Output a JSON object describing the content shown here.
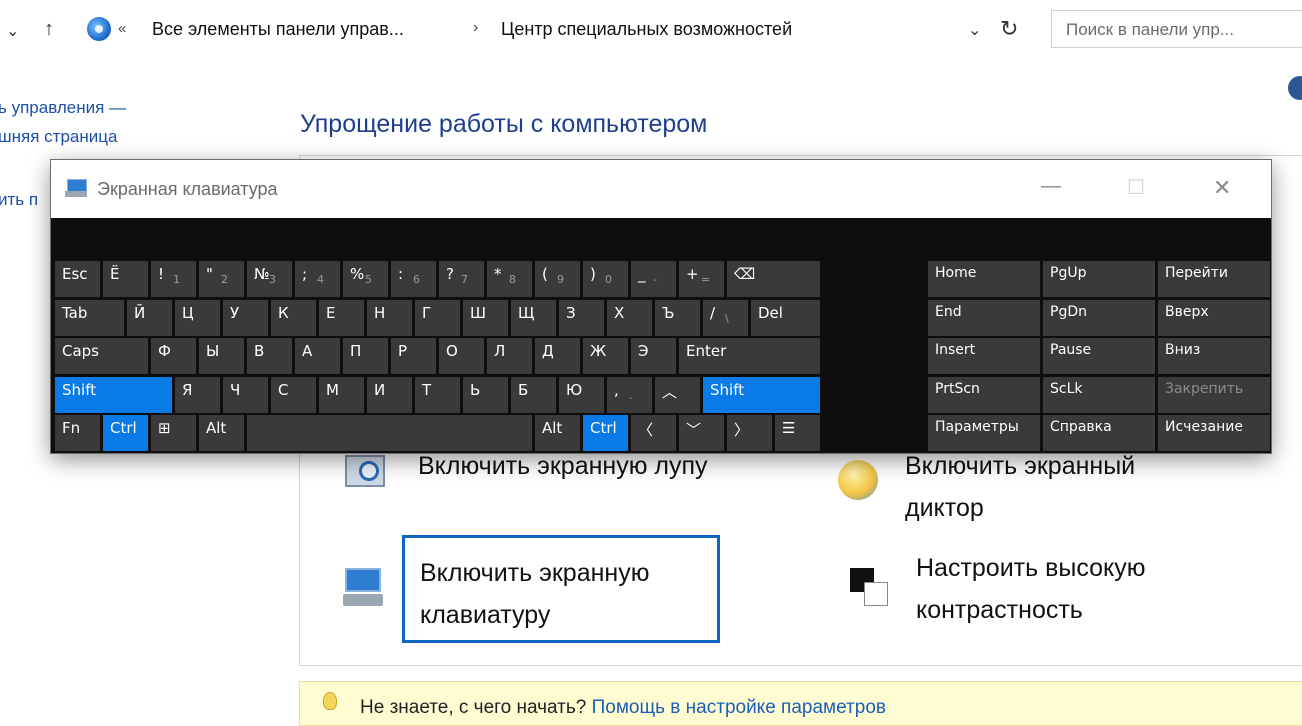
{
  "address_bar": {
    "overflow": "«",
    "crumb1": "Все элементы панели управ...",
    "separator": "›",
    "crumb2": "Центр специальных возможностей",
    "search_placeholder": "Поиск в панели упр..."
  },
  "left_pane": {
    "link_line1": "ь управления —",
    "link_line2": "шняя страница",
    "link_partial": "ить п"
  },
  "main": {
    "title": "Упрощение работы с компьютером",
    "options": {
      "magnifier": "Включить экранную лупу",
      "narrator_line1": "Включить экранный",
      "narrator_line2": "диктор",
      "keyboard_line1": "Включить экранную",
      "keyboard_line2": "клавиатуру",
      "contrast_line1": "Настроить высокую",
      "contrast_line2": "контрастность"
    },
    "tip": {
      "text": "Не знаете, с чего начать?",
      "link": "Помощь в настройке параметров"
    }
  },
  "osk": {
    "title": "Экранная клавиатура",
    "rows": [
      [
        {
          "n": "key-esc",
          "m": "Esc",
          "w": 1
        },
        {
          "n": "key-yo",
          "m": "Ё",
          "w": 1
        },
        {
          "n": "key-1",
          "m": "!",
          "s": "1",
          "w": 1
        },
        {
          "n": "key-2",
          "m": "\"",
          "s": "2",
          "w": 1
        },
        {
          "n": "key-3",
          "m": "№",
          "s": "3",
          "w": 1
        },
        {
          "n": "key-4",
          "m": ";",
          "s": "4",
          "w": 1
        },
        {
          "n": "key-5",
          "m": "%",
          "s": "5",
          "w": 1
        },
        {
          "n": "key-6",
          "m": ":",
          "s": "6",
          "w": 1
        },
        {
          "n": "key-7",
          "m": "?",
          "s": "7",
          "w": 1
        },
        {
          "n": "key-8",
          "m": "*",
          "s": "8",
          "w": 1
        },
        {
          "n": "key-9",
          "m": "(",
          "s": "9",
          "w": 1
        },
        {
          "n": "key-0",
          "m": ")",
          "s": "0",
          "w": 1
        },
        {
          "n": "key-minus",
          "m": "_",
          "s": "-",
          "w": 1
        },
        {
          "n": "key-equals",
          "m": "+",
          "s": "=",
          "w": 1
        },
        {
          "n": "key-backspace",
          "m": "⌫",
          "w": 2
        }
      ],
      [
        {
          "n": "key-tab",
          "m": "Tab",
          "w": 1.5
        },
        {
          "n": "key-й",
          "m": "Й",
          "w": 1
        },
        {
          "n": "key-ц",
          "m": "Ц",
          "w": 1
        },
        {
          "n": "key-у",
          "m": "У",
          "w": 1
        },
        {
          "n": "key-к",
          "m": "К",
          "w": 1
        },
        {
          "n": "key-е",
          "m": "Е",
          "w": 1
        },
        {
          "n": "key-н",
          "m": "Н",
          "w": 1
        },
        {
          "n": "key-г",
          "m": "Г",
          "w": 1
        },
        {
          "n": "key-ш",
          "m": "Ш",
          "w": 1
        },
        {
          "n": "key-щ",
          "m": "Щ",
          "w": 1
        },
        {
          "n": "key-з",
          "m": "З",
          "w": 1
        },
        {
          "n": "key-х",
          "m": "Х",
          "w": 1
        },
        {
          "n": "key-ъ",
          "m": "Ъ",
          "w": 1
        },
        {
          "n": "key-slash",
          "m": "/",
          "s": "\\",
          "w": 1
        },
        {
          "n": "key-del",
          "m": "Del",
          "w": 1.5
        }
      ],
      [
        {
          "n": "key-caps",
          "m": "Caps",
          "w": 2
        },
        {
          "n": "key-ф",
          "m": "Ф",
          "w": 1
        },
        {
          "n": "key-ы",
          "m": "Ы",
          "w": 1
        },
        {
          "n": "key-в",
          "m": "В",
          "w": 1
        },
        {
          "n": "key-а",
          "m": "А",
          "w": 1
        },
        {
          "n": "key-п",
          "m": "П",
          "w": 1
        },
        {
          "n": "key-р",
          "m": "Р",
          "w": 1
        },
        {
          "n": "key-о",
          "m": "О",
          "w": 1
        },
        {
          "n": "key-л",
          "m": "Л",
          "w": 1
        },
        {
          "n": "key-д",
          "m": "Д",
          "w": 1
        },
        {
          "n": "key-ж",
          "m": "Ж",
          "w": 1
        },
        {
          "n": "key-э",
          "m": "Э",
          "w": 1
        },
        {
          "n": "key-enter",
          "m": "Enter",
          "w": 3
        }
      ],
      [
        {
          "n": "key-shift-left",
          "m": "Shift",
          "w": 2.5,
          "blue": true
        },
        {
          "n": "key-я",
          "m": "Я",
          "w": 1
        },
        {
          "n": "key-ч",
          "m": "Ч",
          "w": 1
        },
        {
          "n": "key-с",
          "m": "С",
          "w": 1
        },
        {
          "n": "key-м",
          "m": "М",
          "w": 1
        },
        {
          "n": "key-и",
          "m": "И",
          "w": 1
        },
        {
          "n": "key-т",
          "m": "Т",
          "w": 1
        },
        {
          "n": "key-ь",
          "m": "Ь",
          "w": 1
        },
        {
          "n": "key-б",
          "m": "Б",
          "w": 1
        },
        {
          "n": "key-ю",
          "m": "Ю",
          "w": 1
        },
        {
          "n": "key-period",
          "m": ",",
          "s": ".",
          "w": 1
        },
        {
          "n": "key-arrow-up",
          "m": "︿",
          "w": 1
        },
        {
          "n": "key-shift-right",
          "m": "Shift",
          "w": 2.5,
          "blue": true
        }
      ],
      [
        {
          "n": "key-fn",
          "m": "Fn",
          "w": 1
        },
        {
          "n": "key-ctrl-left",
          "m": "Ctrl",
          "w": 1,
          "blue": true
        },
        {
          "n": "key-win",
          "m": "⊞",
          "w": 1
        },
        {
          "n": "key-alt-left",
          "m": "Alt",
          "w": 1
        },
        {
          "n": "key-space",
          "m": "",
          "w": 6
        },
        {
          "n": "key-alt-right",
          "m": "Alt",
          "w": 1
        },
        {
          "n": "key-ctrl-right",
          "m": "Ctrl",
          "w": 1,
          "blue": true
        },
        {
          "n": "key-arrow-left",
          "m": "〈",
          "w": 1
        },
        {
          "n": "key-arrow-down",
          "m": "﹀",
          "w": 1
        },
        {
          "n": "key-arrow-right",
          "m": "〉",
          "w": 1
        },
        {
          "n": "key-menu",
          "m": "☰",
          "w": 1
        }
      ]
    ],
    "nav_keys": [
      [
        "Home",
        "PgUp",
        "Перейти"
      ],
      [
        "End",
        "PgDn",
        "Вверх"
      ],
      [
        "Insert",
        "Pause",
        "Вниз"
      ],
      [
        "PrtScn",
        "ScLk",
        "Закрепить"
      ],
      [
        "Параметры",
        "Справка",
        "Исчезание"
      ]
    ],
    "disabled_keys": [
      "Закрепить"
    ]
  },
  "colors": {
    "accent": "#0a7ae6",
    "key_bg": "#3a3a3a",
    "link": "#1c4fa5",
    "title": "#1e3f8c"
  }
}
